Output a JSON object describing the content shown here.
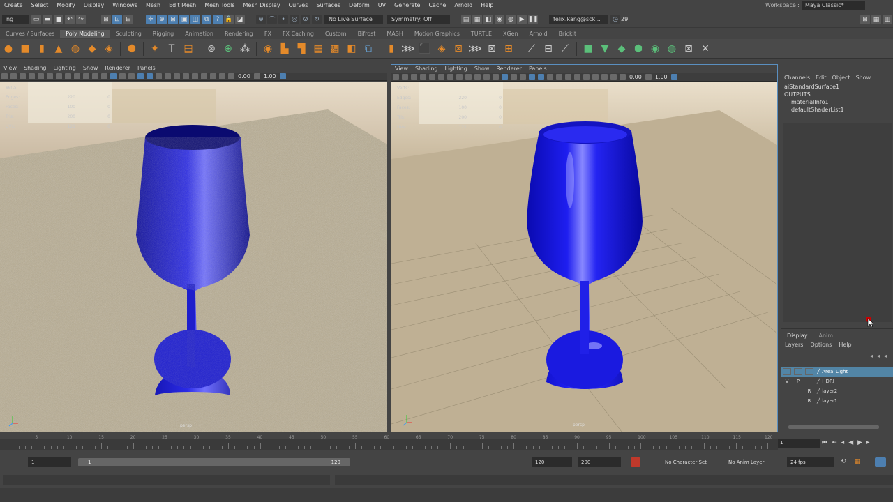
{
  "menubar": {
    "items": [
      "Create",
      "Select",
      "Modify",
      "Display",
      "Windows",
      "Mesh",
      "Edit Mesh",
      "Mesh Tools",
      "Mesh Display",
      "Curves",
      "Surfaces",
      "Deform",
      "UV",
      "Generate",
      "Cache",
      "Arnold",
      "Help"
    ],
    "workspace_label": "Workspace :",
    "workspace_value": "Maya Classic*"
  },
  "statusline": {
    "mode": "ng",
    "live_surface": "No Live Surface",
    "symmetry": "Symmetry: Off",
    "user": "felix.kang@sck...",
    "notifications": "29"
  },
  "shelf_tabs": [
    "Curves / Surfaces",
    "Poly Modeling",
    "Sculpting",
    "Rigging",
    "Animation",
    "Rendering",
    "FX",
    "FX Caching",
    "Custom",
    "Bifrost",
    "MASH",
    "Motion Graphics",
    "TURTLE",
    "XGen",
    "Arnold",
    "Brickit"
  ],
  "shelf_active": "Poly Modeling",
  "viewport_menu": [
    "View",
    "Shading",
    "Lighting",
    "Show",
    "Renderer",
    "Panels"
  ],
  "viewport_values": {
    "near": "0.00",
    "far": "1.00"
  },
  "hud": {
    "rows": [
      {
        "label": "Verts:",
        "v1": "",
        "v2": ""
      },
      {
        "label": "Edges:",
        "v1": "220",
        "v2": "0"
      },
      {
        "label": "Faces:",
        "v1": "100",
        "v2": "0"
      },
      {
        "label": "Tris:",
        "v1": "200",
        "v2": "0"
      },
      {
        "label": "UVs:",
        "v1": "121",
        "v2": "0"
      }
    ]
  },
  "camera_label": "persp",
  "channelbox": {
    "menu": [
      "Channels",
      "Edit",
      "Object",
      "Show"
    ],
    "node": "aiStandardSurface1",
    "outputs_label": "OUTPUTS",
    "outputs": [
      "materialInfo1",
      "defaultShaderList1"
    ]
  },
  "layers": {
    "tabs": [
      "Display",
      "Anim"
    ],
    "menu": [
      "Layers",
      "Options",
      "Help"
    ],
    "rows": [
      {
        "v": "",
        "p": "",
        "r": "",
        "name": "Area_Light",
        "selected": true
      },
      {
        "v": "V",
        "p": "P",
        "r": "",
        "name": "HDRI",
        "selected": false
      },
      {
        "v": "",
        "p": "",
        "r": "R",
        "name": "layer2",
        "selected": false
      },
      {
        "v": "",
        "p": "",
        "r": "R",
        "name": "layer1",
        "selected": false
      }
    ]
  },
  "timeline": {
    "ticks": [
      "5",
      "10",
      "15",
      "20",
      "25",
      "30",
      "35",
      "40",
      "45",
      "50",
      "55",
      "60",
      "65",
      "70",
      "75",
      "80",
      "85",
      "90",
      "95",
      "100",
      "105",
      "110",
      "115",
      "120"
    ],
    "current_frame": "1"
  },
  "range": {
    "start": "1",
    "inner_start": "1",
    "inner_end": "120",
    "end": "120",
    "anim_end": "200",
    "character_set": "No Character Set",
    "anim_layer": "No Anim Layer",
    "fps": "24 fps"
  },
  "colors": {
    "glass": "#1a1ad8",
    "accent": "#5285a6"
  }
}
